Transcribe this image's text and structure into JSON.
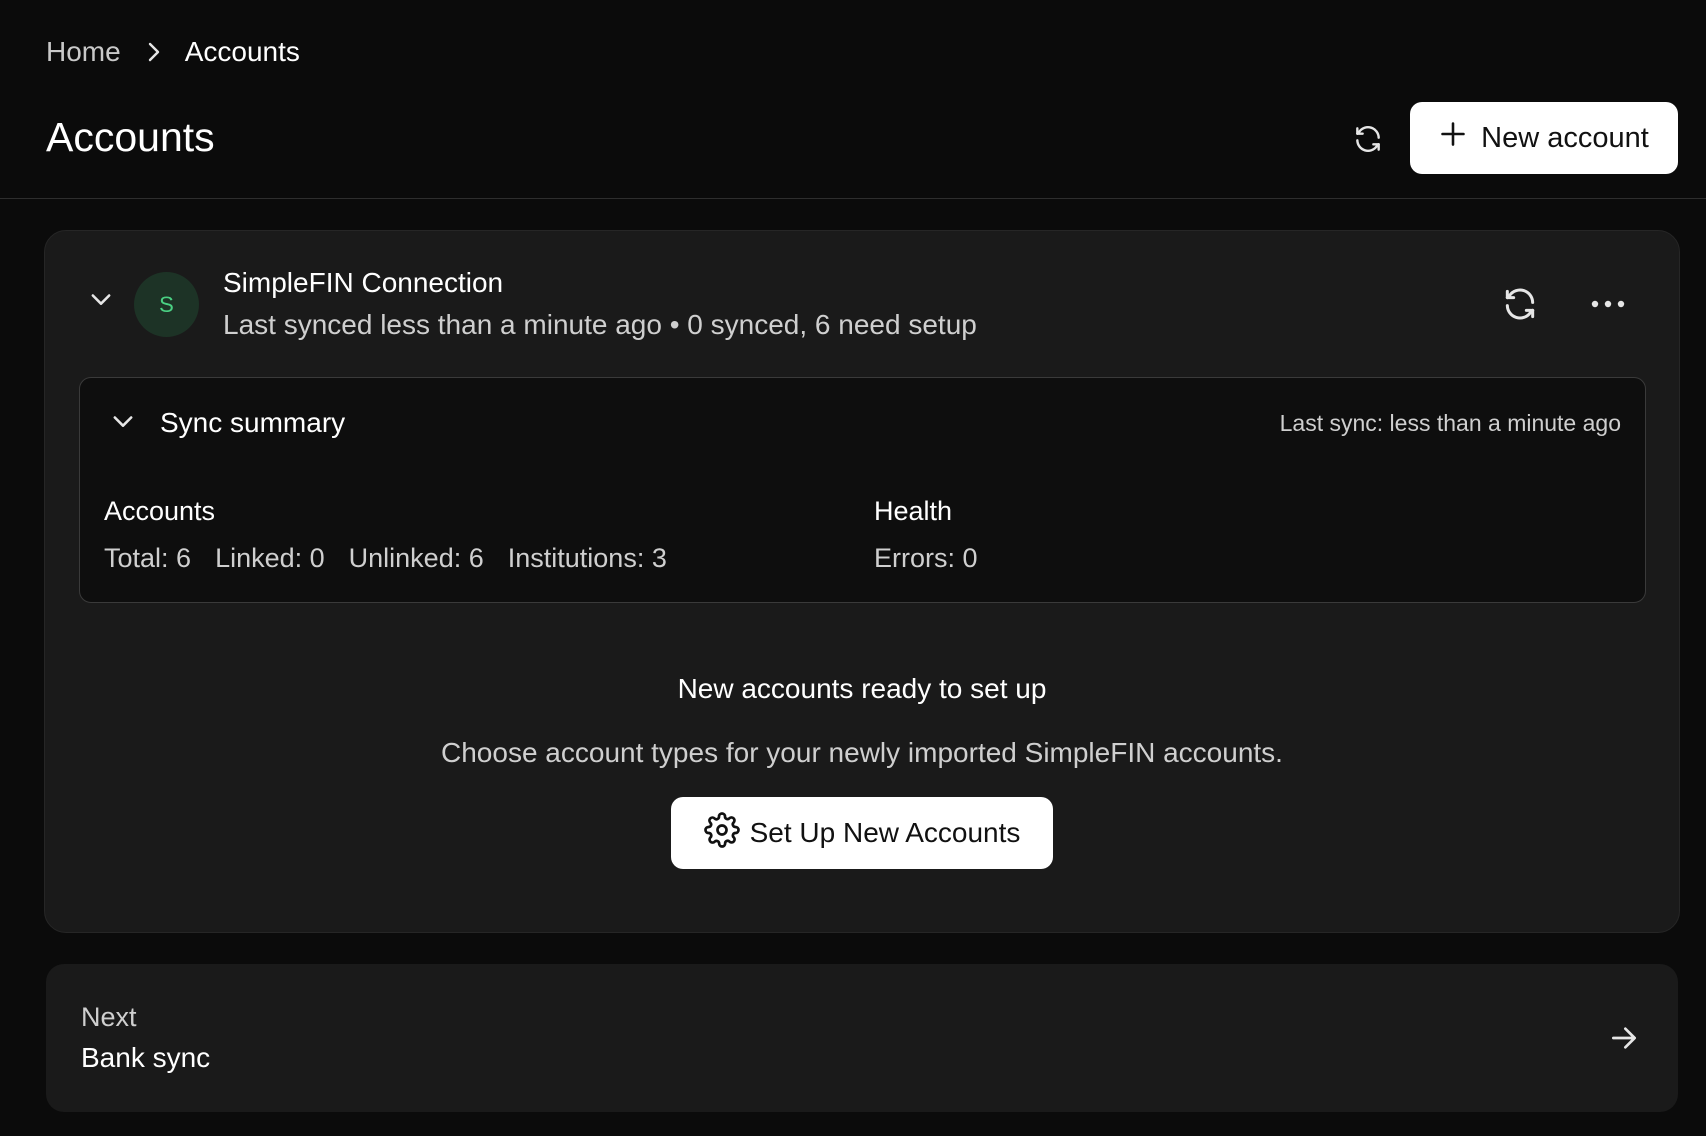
{
  "breadcrumb": {
    "home": "Home",
    "current": "Accounts",
    "separator_icon": "chevron-right-icon"
  },
  "header": {
    "title": "Accounts",
    "sync_icon": "refresh-icon",
    "new_account_label": "New account",
    "new_account_icon": "plus-icon"
  },
  "connection": {
    "avatar_letter": "S",
    "name": "SimpleFIN Connection",
    "meta": "Last synced less than a minute ago • 0 synced, 6 need setup",
    "sync_icon": "refresh-icon",
    "more_icon": "more-horizontal-icon",
    "collapse_icon": "chevron-down-icon"
  },
  "summary": {
    "title": "Sync summary",
    "last_sync": "Last sync: less than a minute ago",
    "accounts": {
      "heading": "Accounts",
      "total": "Total: 6",
      "linked": "Linked: 0",
      "unlinked": "Unlinked: 6",
      "institutions": "Institutions: 3"
    },
    "health": {
      "heading": "Health",
      "errors": "Errors: 0"
    }
  },
  "ready": {
    "title": "New accounts ready to set up",
    "description": "Choose account types for your newly imported SimpleFIN accounts.",
    "button_label": "Set Up New Accounts",
    "button_icon": "gear-icon"
  },
  "next": {
    "label": "Next",
    "title": "Bank sync",
    "icon": "arrow-right-icon"
  },
  "colors": {
    "background": "#0b0b0b",
    "card": "#1a1a1a",
    "avatar_bg": "#1d3326",
    "avatar_fg": "#4ad083",
    "button_bg": "#ffffff"
  }
}
